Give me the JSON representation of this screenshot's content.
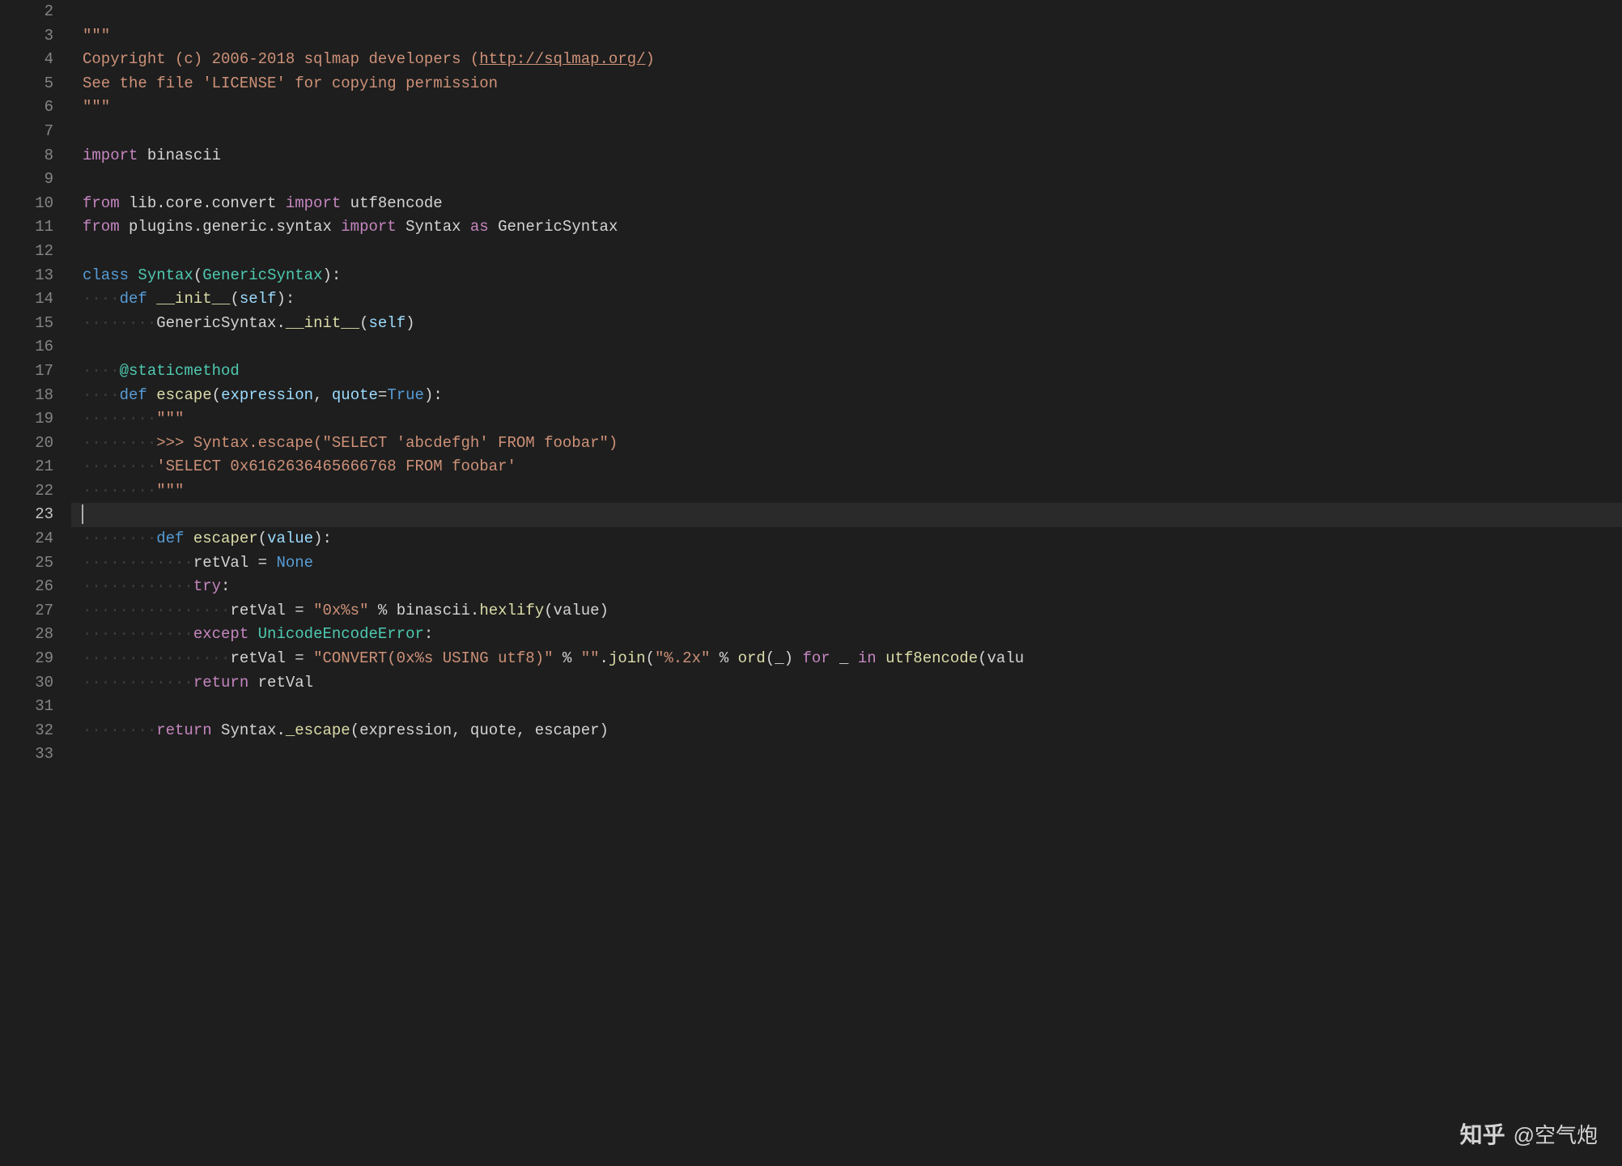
{
  "watermark": {
    "brand": "知乎",
    "author": "@空气炮"
  },
  "lines": {
    "l2": "",
    "l3_docstart": "\"\"\"",
    "l4_a": "Copyright (c) 2006-2018 sqlmap developers (",
    "l4_b": "http://sqlmap.org/",
    "l4_c": ")",
    "l5": "See the file 'LICENSE' for copying permission",
    "l6_docend": "\"\"\"",
    "l8_import": "import",
    "l8_mod": " binascii",
    "l10_from": "from",
    "l10_p1": " lib.core.convert ",
    "l10_import": "import",
    "l10_p2": " utf8encode",
    "l11_from": "from",
    "l11_p1": " plugins.generic.syntax ",
    "l11_import": "import",
    "l11_p2": " Syntax ",
    "l11_as": "as",
    "l11_p3": " GenericSyntax",
    "l13_class": "class",
    "l13_sp": " ",
    "l13_name": "Syntax",
    "l13_paren1": "(",
    "l13_base": "GenericSyntax",
    "l13_paren2": "):",
    "l14_def": "def",
    "l14_sp": " ",
    "l14_fn": "__init__",
    "l14_p1": "(",
    "l14_self": "self",
    "l14_p2": "):",
    "l15_call": "GenericSyntax.",
    "l15_fn": "__init__",
    "l15_p1": "(",
    "l15_self": "self",
    "l15_p2": ")",
    "l17_dec": "@staticmethod",
    "l18_def": "def",
    "l18_sp": " ",
    "l18_fn": "escape",
    "l18_p1": "(",
    "l18_a1": "expression",
    "l18_c": ", ",
    "l18_a2": "quote",
    "l18_eq": "=",
    "l18_true": "True",
    "l18_p2": "):",
    "l19_doc": "\"\"\"",
    "l20_doc": ">>> Syntax.escape(\"SELECT 'abcdefgh' FROM foobar\")",
    "l21_doc": "'SELECT 0x6162636465666768 FROM foobar'",
    "l22_doc": "\"\"\"",
    "l24_def": "def",
    "l24_sp": " ",
    "l24_fn": "escaper",
    "l24_p1": "(",
    "l24_a": "value",
    "l24_p2": "):",
    "l25_var": "retVal = ",
    "l25_none": "None",
    "l26_try": "try",
    "l26_c": ":",
    "l27_var": "retVal = ",
    "l27_str": "\"0x%s\"",
    "l27_op": " % binascii.",
    "l27_fn": "hexlify",
    "l27_p1": "(value)",
    "l28_except": "except",
    "l28_sp": " ",
    "l28_exc": "UnicodeEncodeError",
    "l28_c": ":",
    "l29_var": "retVal = ",
    "l29_s1": "\"CONVERT(0x%s USING utf8)\"",
    "l29_op1": " % ",
    "l29_s2": "\"\"",
    "l29_op2": ".",
    "l29_fn": "join",
    "l29_p1": "(",
    "l29_s3": "\"%.2x\"",
    "l29_op3": " % ",
    "l29_ord": "ord",
    "l29_p2": "(_) ",
    "l29_for": "for",
    "l29_v": " _ ",
    "l29_in": "in",
    "l29_call": " ",
    "l29_fn2": "utf8encode",
    "l29_p3": "(valu",
    "l30_ret": "return",
    "l30_v": " retVal",
    "l32_ret": "return",
    "l32_call": " Syntax.",
    "l32_fn": "_escape",
    "l32_p": "(expression, quote, escaper)"
  },
  "gutter": [
    "2",
    "3",
    "4",
    "5",
    "6",
    "7",
    "8",
    "9",
    "10",
    "11",
    "12",
    "13",
    "14",
    "15",
    "16",
    "17",
    "18",
    "19",
    "20",
    "21",
    "22",
    "23",
    "24",
    "25",
    "26",
    "27",
    "28",
    "29",
    "30",
    "31",
    "32",
    "33"
  ],
  "ws4": "····",
  "ws8": "········",
  "ws12": "············",
  "ws16": "················"
}
